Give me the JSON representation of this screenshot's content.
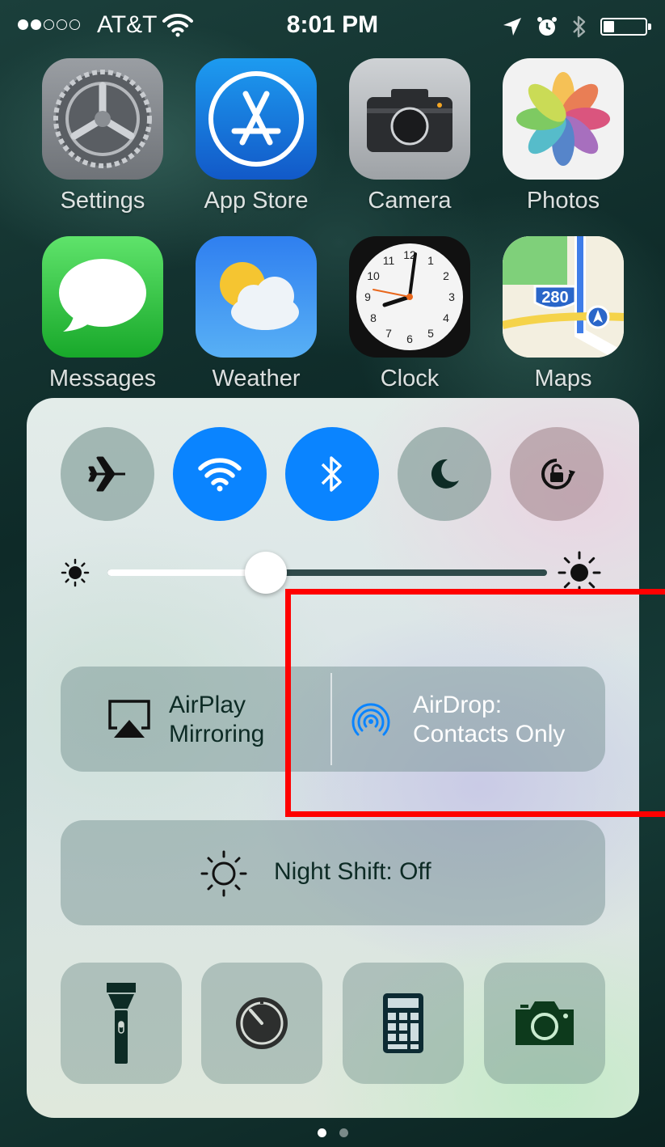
{
  "status_bar": {
    "signal_dots": 5,
    "signal_filled": 2,
    "carrier": "AT&T",
    "time": "8:01 PM",
    "battery_level": 0.25
  },
  "home_apps": [
    {
      "label": "Settings",
      "icon": "settings-icon"
    },
    {
      "label": "App Store",
      "icon": "app-store-icon"
    },
    {
      "label": "Camera",
      "icon": "camera-icon"
    },
    {
      "label": "Photos",
      "icon": "photos-icon"
    },
    {
      "label": "Messages",
      "icon": "messages-icon"
    },
    {
      "label": "Weather",
      "icon": "weather-icon"
    },
    {
      "label": "Clock",
      "icon": "clock-icon"
    },
    {
      "label": "Maps",
      "icon": "maps-icon"
    }
  ],
  "clock_face_numbers": [
    "12",
    "1",
    "2",
    "3",
    "4",
    "5",
    "6",
    "7",
    "8",
    "9",
    "10",
    "11"
  ],
  "maps_sign": "280",
  "control_center": {
    "toggles": [
      {
        "name": "airplane-mode",
        "state": "off"
      },
      {
        "name": "wifi",
        "state": "on"
      },
      {
        "name": "bluetooth",
        "state": "on"
      },
      {
        "name": "do-not-disturb",
        "state": "off"
      },
      {
        "name": "rotation-lock",
        "state": "off"
      }
    ],
    "brightness": 0.36,
    "airplay": {
      "line1": "AirPlay",
      "line2": "Mirroring"
    },
    "airdrop": {
      "line1": "AirDrop:",
      "line2": "Contacts Only"
    },
    "night_shift": "Night Shift: Off",
    "shortcuts": [
      "flashlight",
      "timer",
      "calculator",
      "camera"
    ]
  },
  "page_indicator": {
    "count": 2,
    "active": 0
  },
  "colors": {
    "accent": "#0a84ff",
    "highlight": "#ff0000",
    "dark_icon": "#0d2b25"
  }
}
